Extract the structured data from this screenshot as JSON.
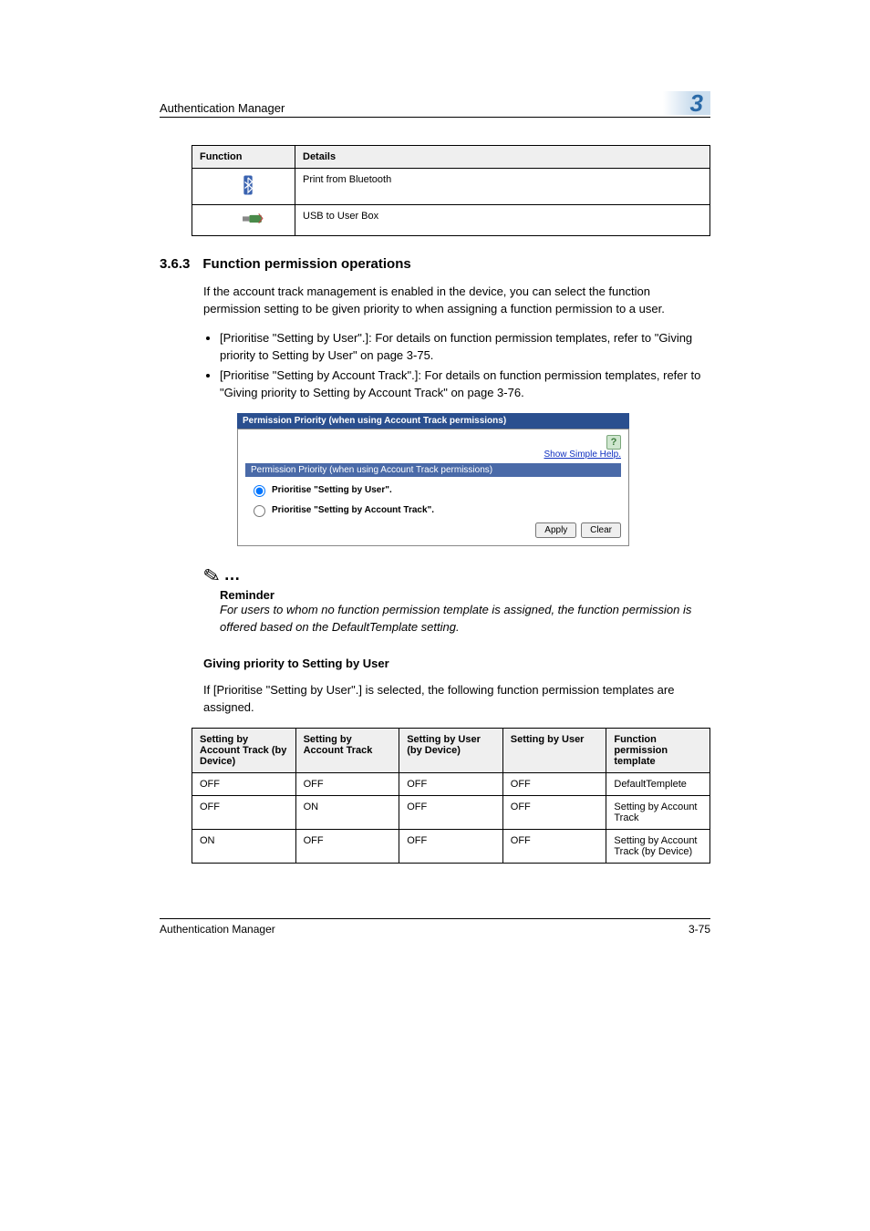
{
  "header": {
    "title": "Authentication Manager",
    "chapter": "3"
  },
  "fn_table": {
    "headers": {
      "function": "Function",
      "details": "Details"
    },
    "rows": [
      {
        "icon": "bluetooth-icon",
        "detail": "Print from Bluetooth"
      },
      {
        "icon": "usb-icon",
        "detail": "USB to User Box"
      }
    ]
  },
  "section": {
    "number": "3.6.3",
    "title": "Function permission operations",
    "intro": "If the account track management is enabled in the device, you can select the function permission setting to be given priority to when assigning a function permission to a user.",
    "bullets": [
      "[Prioritise \"Setting by User\".]: For details on function permission templates, refer to \"Giving priority to Setting by User\" on page 3-75.",
      "[Prioritise \"Setting by Account Track\".]: For details on function permission templates, refer to \"Giving priority to Setting by Account Track\" on page 3-76."
    ]
  },
  "panel": {
    "titlebar": "Permission Priority (when using Account Track permissions)",
    "show_simple_help": "Show Simple Help.",
    "section_head": "Permission Priority (when using Account Track permissions)",
    "radio1": "Prioritise \"Setting by User\".",
    "radio2": "Prioritise \"Setting by Account Track\".",
    "apply": "Apply",
    "clear": "Clear"
  },
  "note": {
    "head": "Reminder",
    "body": "For users to whom no function permission template is assigned, the function permission is offered based on the DefaultTemplate setting."
  },
  "subsection": {
    "title": "Giving priority to Setting by User",
    "intro": "If [Prioritise \"Setting by User\".] is selected, the following function permission templates are assigned."
  },
  "priority_table": {
    "headers": {
      "c1": "Setting by Account Track (by Device)",
      "c2": "Setting by Account Track",
      "c3": "Setting by User (by Device)",
      "c4": "Setting by User",
      "c5": "Function permission template"
    },
    "rows": [
      {
        "c1": "OFF",
        "c2": "OFF",
        "c3": "OFF",
        "c4": "OFF",
        "c5": "DefaultTemplete"
      },
      {
        "c1": "OFF",
        "c2": "ON",
        "c3": "OFF",
        "c4": "OFF",
        "c5": "Setting by Account Track"
      },
      {
        "c1": "ON",
        "c2": "OFF",
        "c3": "OFF",
        "c4": "OFF",
        "c5": "Setting by Account Track (by Device)"
      }
    ]
  },
  "footer": {
    "left": "Authentication Manager",
    "right": "3-75"
  }
}
